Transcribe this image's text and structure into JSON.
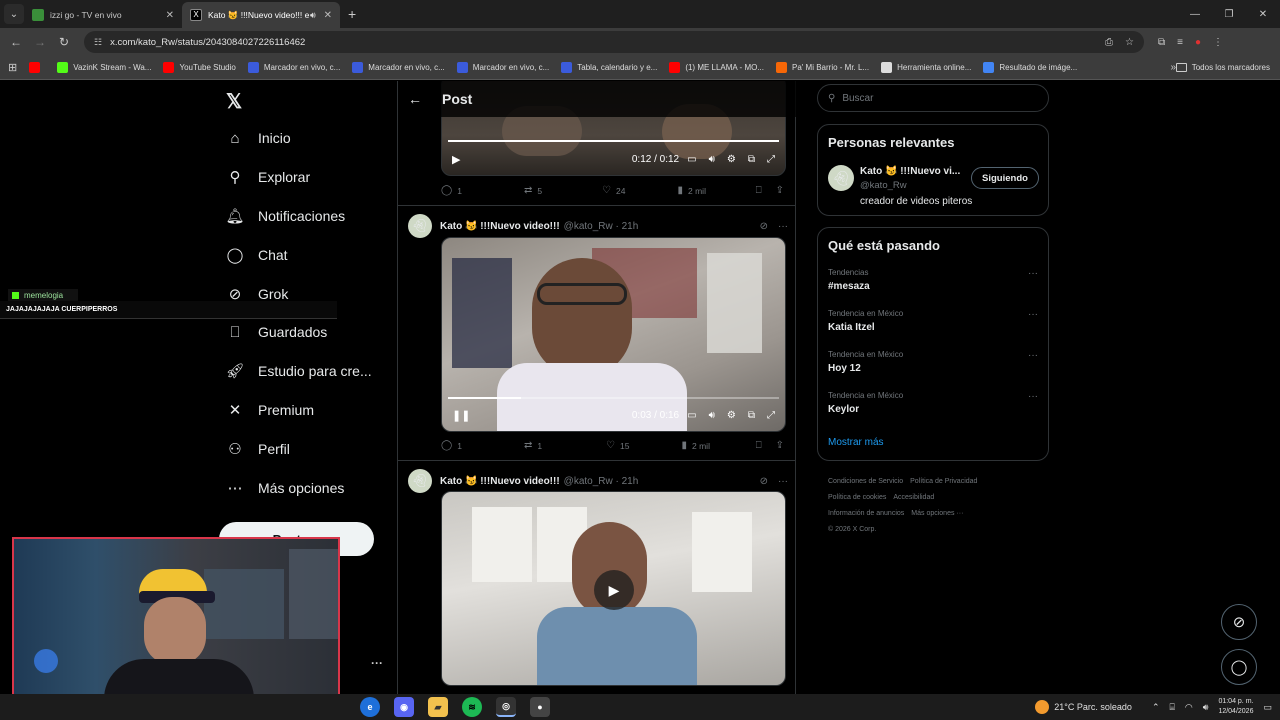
{
  "browser": {
    "tabs": [
      {
        "title": "izzi go - TV en vivo",
        "active": false
      },
      {
        "title": "Kato 😼 !!!Nuevo video!!! e",
        "active": true
      }
    ],
    "url": "x.com/kato_Rw/status/2043084027226116462",
    "bookmarks": [
      {
        "label": "",
        "color": "#ff0000"
      },
      {
        "label": "VazinK Stream - Wa...",
        "color": "#53fc18"
      },
      {
        "label": "YouTube Studio",
        "color": "#ff0000"
      },
      {
        "label": "Marcador en vivo, c...",
        "color": "#3b5bdb"
      },
      {
        "label": "Marcador en vivo, c...",
        "color": "#3b5bdb"
      },
      {
        "label": "Marcador en vivo, c...",
        "color": "#3b5bdb"
      },
      {
        "label": "Tabla, calendario y e...",
        "color": "#3b5bdb"
      },
      {
        "label": "(1) ME LLAMA - MO...",
        "color": "#ff0000"
      },
      {
        "label": "Pa' Mi Barrio - Mr. L...",
        "color": "#f76707"
      },
      {
        "label": "Herramienta online...",
        "color": "#dddddd"
      },
      {
        "label": "Resultado de imáge...",
        "color": "#4285f4"
      }
    ],
    "all_bookmarks": "Todos los marcadores"
  },
  "nav": {
    "items": [
      {
        "label": "Inicio",
        "icon": "home-icon",
        "glyph": "⌂"
      },
      {
        "label": "Explorar",
        "icon": "search-icon",
        "glyph": "⚲"
      },
      {
        "label": "Notificaciones",
        "icon": "bell-icon",
        "glyph": "🔔︎"
      },
      {
        "label": "Chat",
        "icon": "chat-icon",
        "glyph": "◯"
      },
      {
        "label": "Grok",
        "icon": "grok-icon",
        "glyph": "⊘"
      },
      {
        "label": "Guardados",
        "icon": "bookmark-icon",
        "glyph": "⎕"
      },
      {
        "label": "Estudio para cre...",
        "icon": "rocket-icon",
        "glyph": "🚀︎"
      },
      {
        "label": "Premium",
        "icon": "x-premium-icon",
        "glyph": "✕"
      },
      {
        "label": "Perfil",
        "icon": "person-icon",
        "glyph": "⚇"
      },
      {
        "label": "Más opciones",
        "icon": "more-circle-icon",
        "glyph": "⋯"
      }
    ],
    "post_button": "Postear"
  },
  "main": {
    "title": "Post",
    "video1": {
      "time": "0:12 / 0:12",
      "progress": 1.0
    },
    "tweet1_actions": {
      "replies": "1",
      "reposts": "5",
      "likes": "24",
      "views": "2 mil"
    },
    "tweet2": {
      "name": "Kato 😼 !!!Nuevo video!!!",
      "meta": "@kato_Rw · 21h"
    },
    "video2": {
      "time": "0:03 / 0:16",
      "progress": 0.22
    },
    "tweet2_actions": {
      "replies": "1",
      "reposts": "1",
      "likes": "15",
      "views": "2 mil"
    },
    "tweet3": {
      "name": "Kato 😼 !!!Nuevo video!!!",
      "meta": "@kato_Rw · 21h"
    }
  },
  "sidebar": {
    "search_placeholder": "Buscar",
    "relevant_title": "Personas relevantes",
    "person": {
      "name": "Kato 😼 !!!Nuevo vi...",
      "handle": "@kato_Rw",
      "bio": "creador de videos piteros",
      "follow": "Siguiendo"
    },
    "trending_title": "Qué está pasando",
    "trends": [
      {
        "context": "Tendencias",
        "label": "#mesaza"
      },
      {
        "context": "Tendencia en México",
        "label": "Katia Itzel"
      },
      {
        "context": "Tendencia en México",
        "label": "Hoy 12"
      },
      {
        "context": "Tendencia en México",
        "label": "Keylor"
      }
    ],
    "show_more": "Mostrar más",
    "footer": [
      "Condiciones de Servicio",
      "Política de Privacidad",
      "Política de cookies",
      "Accesibilidad",
      "Información de anuncios",
      "Más opciones ···",
      "© 2026 X Corp."
    ]
  },
  "overlay": {
    "chat_user": "memelogia",
    "chat_message": "JAJAJAJAJAJA CUERPIPERROS"
  },
  "taskbar": {
    "weather": "21°C  Parc. soleado",
    "time": "01:04 p. m.",
    "date": "12/04/2026"
  }
}
